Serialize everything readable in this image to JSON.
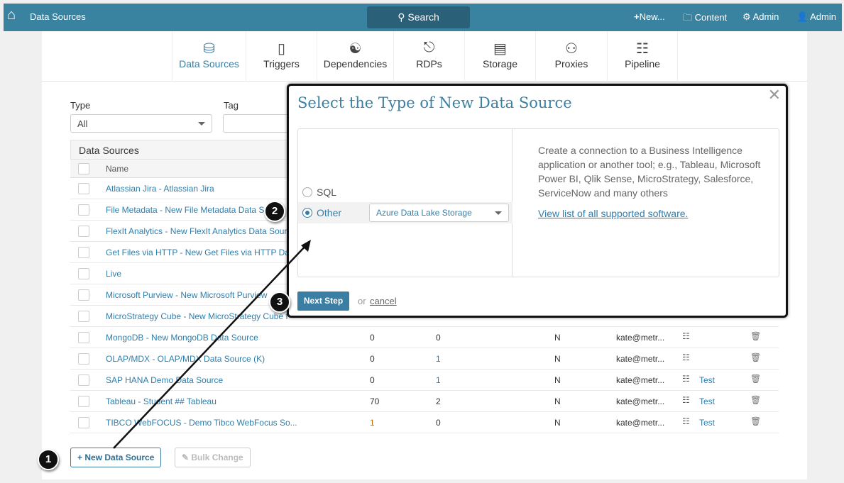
{
  "topbar": {
    "title": "Data Sources",
    "search": "Search",
    "new": "New...",
    "content": "Content",
    "admin_settings": "Admin",
    "user": "Admin"
  },
  "nav": [
    {
      "label": "Data Sources",
      "icon": "database-icon"
    },
    {
      "label": "Triggers",
      "icon": "triggers-icon"
    },
    {
      "label": "Dependencies",
      "icon": "dependencies-icon"
    },
    {
      "label": "RDPs",
      "icon": "rdp-icon"
    },
    {
      "label": "Storage",
      "icon": "storage-icon"
    },
    {
      "label": "Proxies",
      "icon": "proxy-icon"
    },
    {
      "label": "Pipeline",
      "icon": "pipeline-icon"
    }
  ],
  "filters": {
    "type_label": "Type",
    "type_value": "All",
    "tag_label": "Tag",
    "tag_value": ""
  },
  "table": {
    "title": "Data Sources",
    "name_header": "Name",
    "rows": [
      {
        "name": "Atlassian Jira - Atlassian Jira"
      },
      {
        "name": "File Metadata - New File Metadata Data S"
      },
      {
        "name": "FlexIt Analytics - New FlexIt Analytics Data Sour"
      },
      {
        "name": "Get Files via HTTP - New Get Files via HTTP Da"
      },
      {
        "name": "Live"
      },
      {
        "name": "Microsoft Purview - New Microsoft Purview"
      },
      {
        "name": "MicroStrategy Cube - New MicroStrategy Cube f"
      },
      {
        "name": "MongoDB - New MongoDB Data Source",
        "c1": "0",
        "c2": "0",
        "c3": "N",
        "owner": "kate@metr...",
        "test": ""
      },
      {
        "name": "OLAP/MDX - OLAP/MDX Data Source (K)",
        "c1": "0",
        "c2": "1",
        "c3": "N",
        "owner": "kate@metr...",
        "test": ""
      },
      {
        "name": "SAP HANA Demo Data Source",
        "c1": "0",
        "c2": "1",
        "c3": "N",
        "owner": "kate@metr...",
        "test": "Test"
      },
      {
        "name": "Tableau - Student ## Tableau",
        "c1": "70",
        "c2": "2",
        "c3": "N",
        "owner": "kate@metr...",
        "test": "Test"
      },
      {
        "name": "TIBCO WebFOCUS - Demo Tibco WebFocus So...",
        "c1": "1",
        "c2": "0",
        "c3": "N",
        "owner": "kate@metr...",
        "test": "Test"
      }
    ]
  },
  "buttons": {
    "new": "New Data Source",
    "bulk": "Bulk Change"
  },
  "dialog": {
    "title": "Select the Type of New Data Source",
    "sql": "SQL",
    "other": "Other",
    "other_value": "Azure Data Lake Storage",
    "description": "Create a connection to a Business Intelligence application or another tool; e.g., Tableau, Microsoft Power BI, Qlik Sense, MicroStrategy, Salesforce, ServiceNow and many others",
    "link": "View list of all supported software.",
    "next": "Next Step",
    "or": "or",
    "cancel": "cancel"
  },
  "annotations": [
    "1",
    "2",
    "3"
  ]
}
